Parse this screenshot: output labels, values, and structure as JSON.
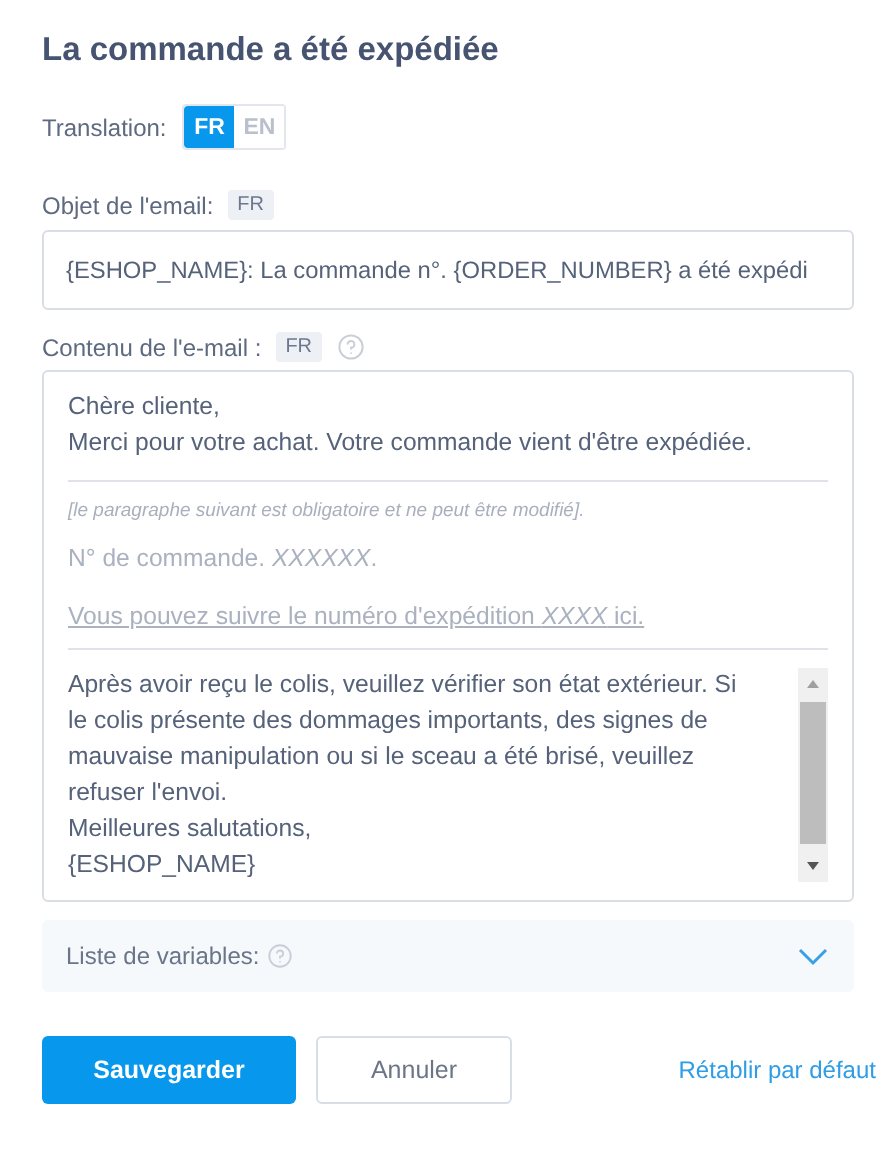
{
  "title": "La commande a été expédiée",
  "translation": {
    "label": "Translation:",
    "options": [
      {
        "label": "FR",
        "selected": true
      },
      {
        "label": "EN",
        "selected": false
      }
    ]
  },
  "subject": {
    "label": "Objet de l'email:",
    "lang": "FR",
    "value": "{ESHOP_NAME}: La commande n°. {ORDER_NUMBER} a été expédi"
  },
  "content": {
    "label": "Contenu de l'e-mail :",
    "lang": "FR",
    "greeting": [
      "Chère cliente,",
      "Merci pour votre achat. Votre commande vient d'être expédiée."
    ],
    "notice": "[le paragraphe suivant est obligatoire et ne peut être modifié].",
    "order_line": "N° de commande. *XXXXXX*.",
    "tracking_link": "Vous pouvez suivre le numéro d'expédition *XXXX* ici.",
    "closing": [
      "Après avoir reçu le colis, veuillez vérifier son état extérieur. Si le colis présente des dommages importants, des signes de mauvaise manipulation ou si le sceau a été brisé, veuillez refuser l'envoi.",
      "Meilleures salutations,",
      "{ESHOP_NAME}"
    ]
  },
  "variables": {
    "label": "Liste de variables:",
    "expanded": false
  },
  "buttons": {
    "save": "Sauvegarder",
    "cancel": "Annuler",
    "reset": "Rétablir par défaut"
  }
}
